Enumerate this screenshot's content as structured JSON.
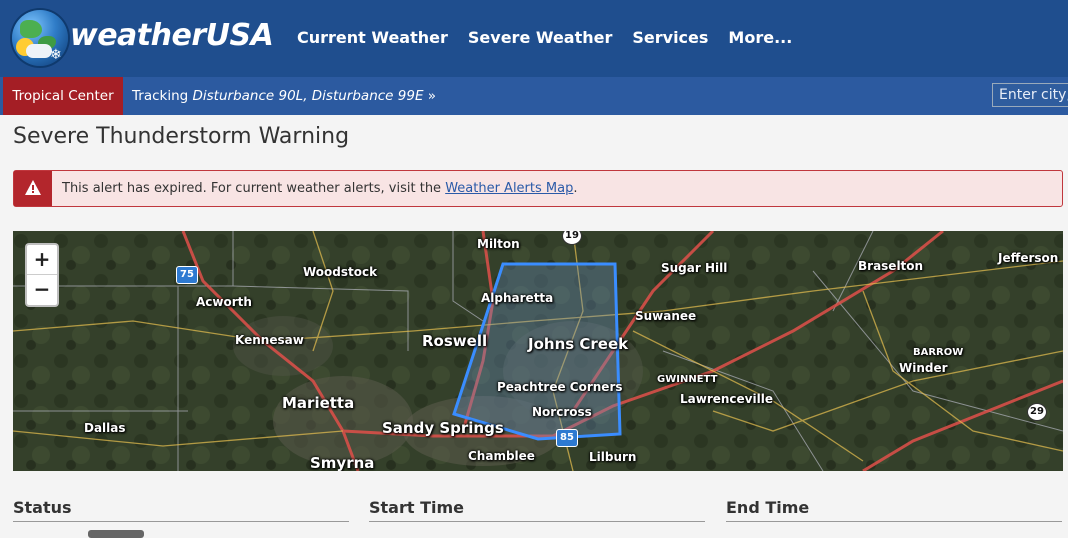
{
  "header": {
    "brand": "weatherUSA",
    "nav": [
      "Current Weather",
      "Severe Weather",
      "Services",
      "More..."
    ]
  },
  "subbar": {
    "tropical_label": "Tropical Center",
    "tracking_prefix": "Tracking",
    "tracking_storms": "Disturbance 90L, Disturbance 99E",
    "tracking_suffix": "»",
    "city_placeholder": "Enter city, zip"
  },
  "page": {
    "title": "Severe Thunderstorm Warning"
  },
  "alert": {
    "text_before": "This alert has expired. For current weather alerts, visit the ",
    "link_text": "Weather Alerts Map",
    "text_after": ".",
    "icon": "warning-triangle-icon",
    "color": "#b3262c"
  },
  "map": {
    "zoom_in": "+",
    "zoom_out": "−",
    "warning_polygon_color": "#3a8dff",
    "places": [
      "Milton",
      "Woodstock",
      "Acworth",
      "Alpharetta",
      "Sugar Hill",
      "Braselton",
      "Jefferson",
      "Kennesaw",
      "Roswell",
      "Johns Creek",
      "Suwanee",
      "BARROW",
      "Winder",
      "GWINNETT",
      "Peachtree Corners",
      "Lawrenceville",
      "Marietta",
      "Norcross",
      "Dallas",
      "Sandy Springs",
      "Chamblee",
      "Lilburn",
      "Smyrna"
    ],
    "shields": [
      "75",
      "19",
      "85",
      "29"
    ]
  },
  "columns": [
    "Status",
    "Start Time",
    "End Time"
  ]
}
